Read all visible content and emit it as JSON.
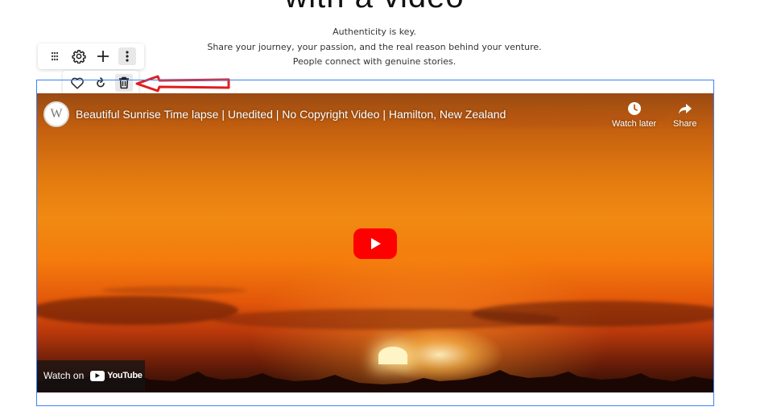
{
  "page": {
    "heading": "with a video",
    "paragraph": [
      "Authenticity is key.",
      "Share your journey, your passion, and the real reason behind your venture.",
      "People connect with genuine stories."
    ]
  },
  "toolbar": {
    "main": [
      "drag-handle-icon",
      "gear-icon",
      "plus-icon",
      "more-vertical-icon"
    ],
    "secondary": [
      "heart-icon",
      "refresh-icon",
      "trash-icon"
    ]
  },
  "video": {
    "channel_initial": "W",
    "title": "Beautiful Sunrise Time lapse | Unedited | No Copyright Video | Hamilton, New Zealand",
    "watch_later_label": "Watch later",
    "share_label": "Share",
    "watch_on_label": "Watch on",
    "youtube_label": "YouTube"
  },
  "colors": {
    "selection": "#3b82f6",
    "annotation_arrow": "#e11d1d",
    "youtube_red": "#ff0000"
  }
}
